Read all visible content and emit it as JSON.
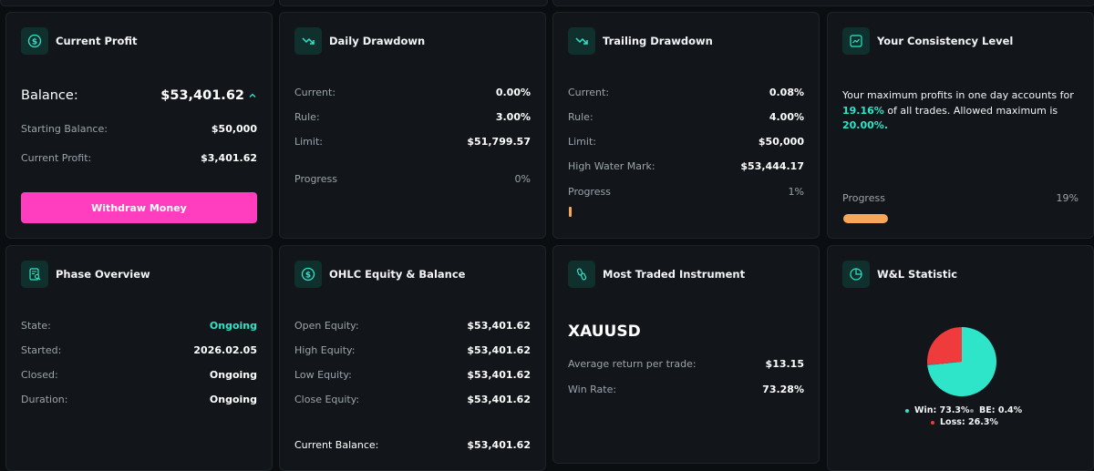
{
  "colors": {
    "accent_teal": "#2ee5c9",
    "button_pink": "#ff3dbe",
    "progress_orange": "#f6a75a",
    "loss_red": "#ef3b3b",
    "be_gray": "#7a7f85"
  },
  "current_profit": {
    "title": "Current Profit",
    "icon": "dollar-circle-icon",
    "balance_label": "Balance:",
    "balance_value": "$53,401.62",
    "trend_icon": "chevron-up-icon",
    "starting_balance_label": "Starting Balance:",
    "starting_balance_value": "$50,000",
    "current_profit_label": "Current Profit:",
    "current_profit_value": "$3,401.62",
    "withdraw_button": "Withdraw Money"
  },
  "daily_drawdown": {
    "title": "Daily Drawdown",
    "icon": "trend-down-icon",
    "current_label": "Current:",
    "current_value": "0.00%",
    "rule_label": "Rule:",
    "rule_value": "3.00%",
    "limit_label": "Limit:",
    "limit_value": "$51,799.57",
    "progress_label": "Progress",
    "progress_value": "0%",
    "progress_fraction": 0
  },
  "trailing_drawdown": {
    "title": "Trailing Drawdown",
    "icon": "trend-down-icon",
    "current_label": "Current:",
    "current_value": "0.08%",
    "rule_label": "Rule:",
    "rule_value": "4.00%",
    "limit_label": "Limit:",
    "limit_value": "$50,000",
    "hwm_label": "High Water Mark:",
    "hwm_value": "$53,444.17",
    "progress_label": "Progress",
    "progress_value": "1%",
    "progress_fraction": 0.01
  },
  "consistency": {
    "title": "Your Consistency Level",
    "icon": "line-chart-icon",
    "text_before": "Your maximum profits in one day accounts for",
    "highlight_1": "19.16%",
    "text_middle": "of all trades. Allowed maximum is",
    "highlight_2": "20.00%",
    "text_end": ".",
    "progress_label": "Progress",
    "progress_value": "19%",
    "progress_fraction": 0.19
  },
  "phase_overview": {
    "title": "Phase Overview",
    "icon": "document-search-icon",
    "state_label": "State:",
    "state_value": "Ongoing",
    "started_label": "Started:",
    "started_value": "2026.02.05",
    "closed_label": "Closed:",
    "closed_value": "Ongoing",
    "duration_label": "Duration:",
    "duration_value": "Ongoing"
  },
  "ohlc": {
    "title": "OHLC Equity & Balance",
    "icon": "dollar-circle-icon",
    "open_label": "Open Equity:",
    "open_value": "$53,401.62",
    "high_label": "High Equity:",
    "high_value": "$53,401.62",
    "low_label": "Low Equity:",
    "low_value": "$53,401.62",
    "close_label": "Close Equity:",
    "close_value": "$53,401.62",
    "balance_label": "Current Balance:",
    "balance_value": "$53,401.62"
  },
  "most_traded": {
    "title": "Most Traded Instrument",
    "icon": "link-icon",
    "instrument": "XAUUSD",
    "avg_label": "Average return per trade:",
    "avg_value": "$13.15",
    "winrate_label": "Win Rate:",
    "winrate_value": "73.28%"
  },
  "wl_stat": {
    "title": "W&L Statistic",
    "icon": "pie-chart-icon",
    "win_label": "Win: 73.3%",
    "be_label": "BE: 0.4%",
    "loss_label": "Loss: 26.3%"
  },
  "chart_data": {
    "type": "pie",
    "categories": [
      "Win",
      "BE",
      "Loss"
    ],
    "values": [
      73.3,
      0.4,
      26.3
    ],
    "colors": [
      "#2ee5c9",
      "#7a7f85",
      "#ef3b3b"
    ]
  }
}
